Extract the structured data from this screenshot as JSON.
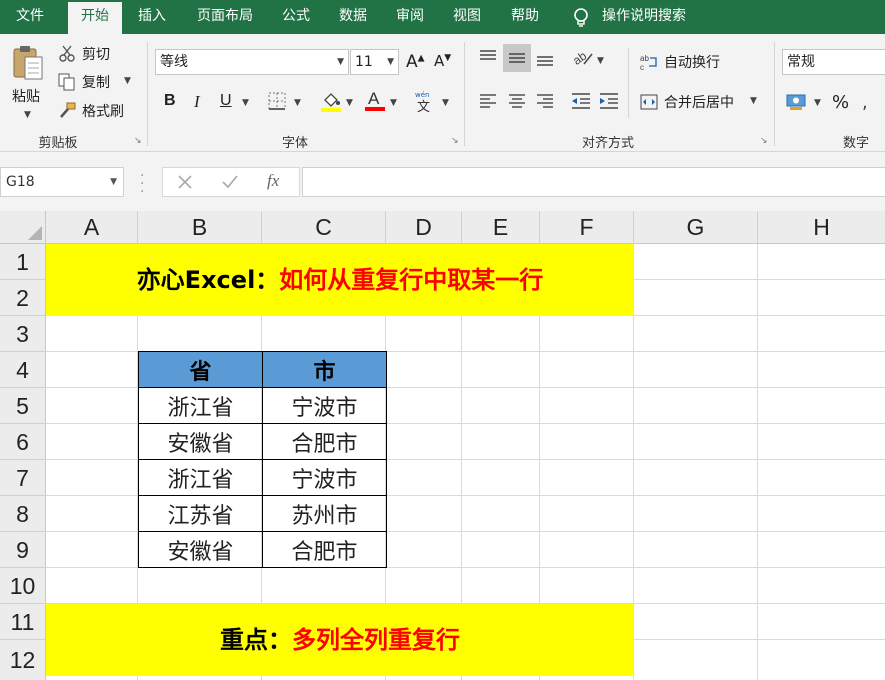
{
  "tabs": [
    "文件",
    "开始",
    "插入",
    "页面布局",
    "公式",
    "数据",
    "审阅",
    "视图",
    "帮助"
  ],
  "tell_me": "操作说明搜索",
  "clipboard": {
    "paste": "粘贴",
    "cut": "剪切",
    "copy": "复制",
    "format_painter": "格式刷",
    "label": "剪贴板"
  },
  "font": {
    "name": "等线",
    "size": "11",
    "bold": "B",
    "italic": "I",
    "underline": "U",
    "label": "字体"
  },
  "alignment": {
    "wrap_text": "自动换行",
    "merge_center": "合并后居中",
    "label": "对齐方式"
  },
  "number": {
    "format": "常规",
    "percent": "%",
    "label": "数字"
  },
  "formula_bar": {
    "name_box": "G18",
    "formula": ""
  },
  "sheet": {
    "columns": [
      "A",
      "B",
      "C",
      "D",
      "E",
      "F",
      "G",
      "H"
    ],
    "rows": [
      "1",
      "2",
      "3",
      "4",
      "5",
      "6",
      "7",
      "8",
      "9",
      "10",
      "11",
      "12"
    ],
    "title_black": "亦心Excel：",
    "title_red": "如何从重复行中取某一行",
    "footer_black": "重点：",
    "footer_red": "多列全列重复行",
    "table": {
      "headers": [
        "省",
        "市"
      ],
      "rows": [
        [
          "浙江省",
          "宁波市"
        ],
        [
          "安徽省",
          "合肥市"
        ],
        [
          "浙江省",
          "宁波市"
        ],
        [
          "江苏省",
          "苏州市"
        ],
        [
          "安徽省",
          "合肥市"
        ]
      ]
    }
  },
  "colors": {
    "accent": "#217346",
    "banner_bg": "#ffff00",
    "header_fill": "#5b9bd5",
    "red_text": "#ff0000"
  }
}
